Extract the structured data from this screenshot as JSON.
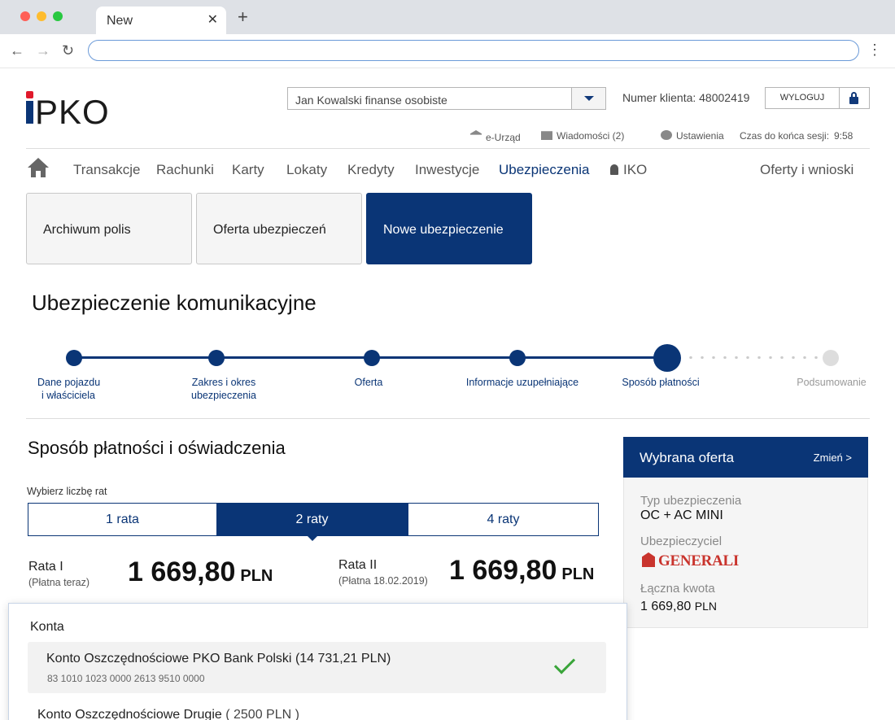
{
  "browser": {
    "tab_title": "New",
    "tab_close": "✕",
    "new_tab": "+",
    "back": "←",
    "forward": "→",
    "reload": "↻",
    "url": "",
    "menu": "⋮"
  },
  "header": {
    "logo_text": "PKO",
    "account_select_value": "Jan Kowalski finanse osobiste",
    "client_number": "Numer klienta: 48002419",
    "logout_label": "WYLOGUJ",
    "links": {
      "e_urzad": "e-Urząd",
      "messages": "Wiadomości (2)",
      "settings": "Ustawienia",
      "session_label": "Czas do końca sesji:",
      "session_time": "9:58"
    }
  },
  "nav": {
    "items": [
      "Transakcje",
      "Rachunki",
      "Karty",
      "Lokaty",
      "Kredyty",
      "Inwestycje",
      "Ubezpieczenia",
      "IKO",
      "Oferty i wnioski"
    ],
    "active": "Ubezpieczenia"
  },
  "tiles": [
    "Archiwum polis",
    "Oferta ubezpieczeń",
    "Nowe ubezpieczenie"
  ],
  "page_title": "Ubezpieczenie komunikacyjne",
  "steps": [
    {
      "line1": "Dane pojazdu",
      "line2": "i właściciela"
    },
    {
      "line1": "Zakres i okres",
      "line2": "ubezpieczenia"
    },
    {
      "line1": "Oferta",
      "line2": ""
    },
    {
      "line1": "Informacje uzupełniające",
      "line2": ""
    },
    {
      "line1": "Sposób płatności",
      "line2": ""
    },
    {
      "line1": "Podsumowanie",
      "line2": ""
    }
  ],
  "current_step": 5,
  "payment": {
    "title": "Sposób płatności i oświadczenia",
    "installments_label": "Wybierz liczbę rat",
    "options": [
      "1 rata",
      "2 raty",
      "4 raty"
    ],
    "selected": "2 raty",
    "rate1": {
      "title": "Rata I",
      "sub": "(Płatna teraz)",
      "amount": "1 669,80",
      "currency": "PLN"
    },
    "rate2": {
      "title": "Rata II",
      "sub": "(Płatna 18.02.2019)",
      "amount": "1 669,80",
      "currency": "PLN"
    }
  },
  "offer": {
    "title": "Wybrana oferta",
    "change": "Zmień >",
    "type_label": "Typ ubezpieczenia",
    "type_value": "OC + AC MINI",
    "insurer_label": "Ubezpieczyciel",
    "insurer_logo": "GENERALI",
    "total_label": "Łączna kwota",
    "total_value": "1 669,80",
    "total_currency": "PLN"
  },
  "accounts": {
    "header": "Konta",
    "items": [
      {
        "name": "Konto Oszczędnościowe PKO Bank Polski",
        "balance": "(14 731,21 PLN)",
        "number": "83 1010 1023 0000 2613 9510 0000",
        "selected": true
      },
      {
        "name": "Konto Oszczędnościowe Drugie",
        "balance": "( 2500 PLN )",
        "number": "",
        "selected": false
      }
    ]
  },
  "colors": {
    "brand_navy": "#0a3576",
    "brand_red": "#e0192b",
    "check_green": "#3aa53a"
  }
}
